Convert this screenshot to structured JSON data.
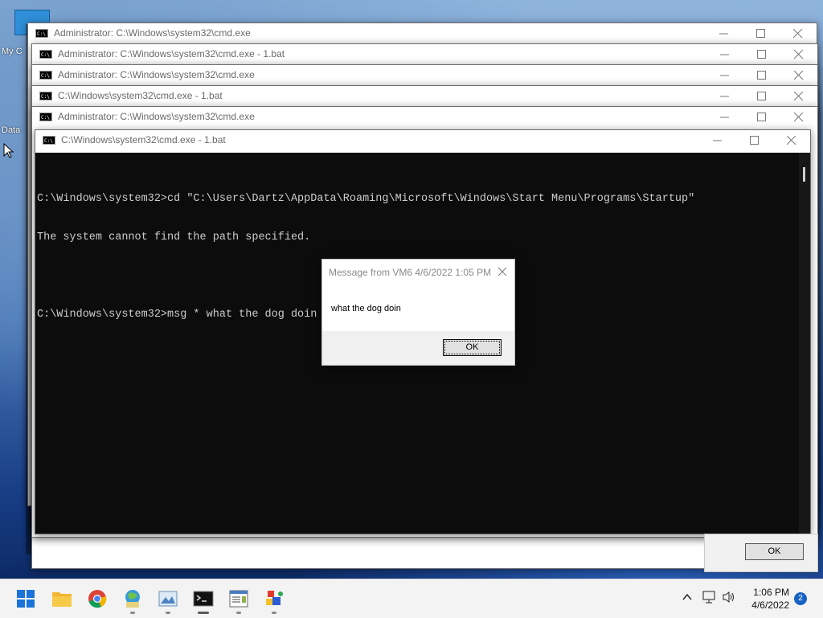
{
  "desktop": {
    "icon_labels": [
      "My C",
      "Data"
    ]
  },
  "windows": [
    {
      "title": "Administrator: C:\\Windows\\system32\\cmd.exe"
    },
    {
      "title": "Administrator: C:\\Windows\\system32\\cmd.exe - 1.bat"
    },
    {
      "title": "Administrator: C:\\Windows\\system32\\cmd.exe"
    },
    {
      "title": "C:\\Windows\\system32\\cmd.exe - 1.bat"
    },
    {
      "title": "Administrator: C:\\Windows\\system32\\cmd.exe"
    },
    {
      "title": "C:\\Windows\\system32\\cmd.exe - 1.bat"
    }
  ],
  "console": {
    "lines": [
      "C:\\Windows\\system32>cd \"C:\\Users\\Dartz\\AppData\\Roaming\\Microsoft\\Windows\\Start Menu\\Programs\\Startup\"",
      "The system cannot find the path specified.",
      "",
      "C:\\Windows\\system32>msg * what the dog doin"
    ]
  },
  "message_box": {
    "title": "Message from VM6 4/6/2022 1:05 PM",
    "text": "what the dog doin",
    "ok_label": "OK"
  },
  "background_dialog": {
    "ok_label": "OK"
  },
  "taskbar": {
    "apps": [
      "start-icon",
      "file-explorer-icon",
      "chrome-icon",
      "network-globe-icon",
      "photo-app-icon",
      "cmd-icon",
      "wordpad-icon",
      "cube-app-icon"
    ],
    "clock_time": "1:06 PM",
    "clock_date": "4/6/2022",
    "notification_count": "2"
  },
  "colors": {
    "console_bg": "#0c0c0c",
    "console_fg": "#cccccc",
    "taskbar_bg": "#f3f3f3",
    "accent": "#1763c4"
  }
}
